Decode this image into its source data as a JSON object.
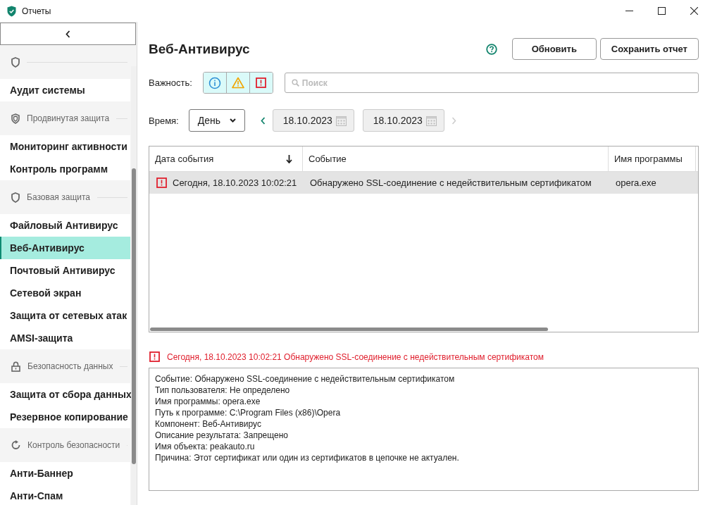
{
  "window": {
    "title": "Отчеты"
  },
  "sidebar": {
    "groups": [
      {
        "items": [
          {
            "label": "Аудит системы",
            "selected": false
          }
        ]
      },
      {
        "title": "Продвинутая защита",
        "items": [
          {
            "label": "Мониторинг активности",
            "selected": false
          },
          {
            "label": "Контроль программ",
            "selected": false
          }
        ]
      },
      {
        "title": "Базовая защита",
        "items": [
          {
            "label": "Файловый Антивирус",
            "selected": false
          },
          {
            "label": "Веб-Антивирус",
            "selected": true
          },
          {
            "label": "Почтовый Антивирус",
            "selected": false
          },
          {
            "label": "Сетевой экран",
            "selected": false
          },
          {
            "label": "Защита от сетевых атак",
            "selected": false
          },
          {
            "label": "AMSI-защита",
            "selected": false
          }
        ]
      },
      {
        "title": "Безопасность данных",
        "items": [
          {
            "label": "Защита от сбора данных",
            "selected": false
          },
          {
            "label": "Резервное копирование",
            "selected": false
          }
        ]
      },
      {
        "title": "Контроль безопасности",
        "items": [
          {
            "label": "Анти-Баннер",
            "selected": false
          },
          {
            "label": "Анти-Спам",
            "selected": false
          }
        ]
      }
    ]
  },
  "header": {
    "title": "Веб-Антивирус",
    "buttons": [
      "Обновить",
      "Сохранить отчет"
    ]
  },
  "filters": {
    "severity_label": "Важность:",
    "severity": [
      {
        "kind": "info",
        "selected": true
      },
      {
        "kind": "warning",
        "selected": true
      },
      {
        "kind": "critical",
        "selected": true
      }
    ],
    "search": {
      "placeholder": "Поиск"
    },
    "time_label": "Время:",
    "period": "День",
    "date_from": "18.10.2023",
    "date_to": "18.10.2023"
  },
  "table": {
    "columns": [
      {
        "label": "Дата события",
        "sorted": true
      },
      {
        "label": "Событие",
        "sorted": false
      },
      {
        "label": "Имя программы",
        "sorted": false
      }
    ],
    "rows": [
      {
        "kind": "critical",
        "selected": true,
        "cells": [
          "Сегодня, 18.10.2023 10:02:21",
          "Обнаружено SSL-соединение с недействительным сертификатом",
          "opera.exe"
        ]
      }
    ]
  },
  "details": {
    "kind": "critical",
    "heading": "Сегодня, 18.10.2023 10:02:21 Обнаружено SSL-соединение с недействительным сертификатом",
    "lines": [
      "Событие: Обнаружено SSL-соединение с недействительным сертификатом",
      "Тип пользователя: Не определено",
      "Имя программы: opera.exe",
      "Путь к программе: C:\\Program Files (x86)\\Opera",
      "Компонент: Веб-Антивирус",
      "Описание результата: Запрещено",
      "Имя объекта: peakauto.ru",
      "Причина: Этот сертификат или один из сертификатов в цепочке не актуален."
    ]
  }
}
